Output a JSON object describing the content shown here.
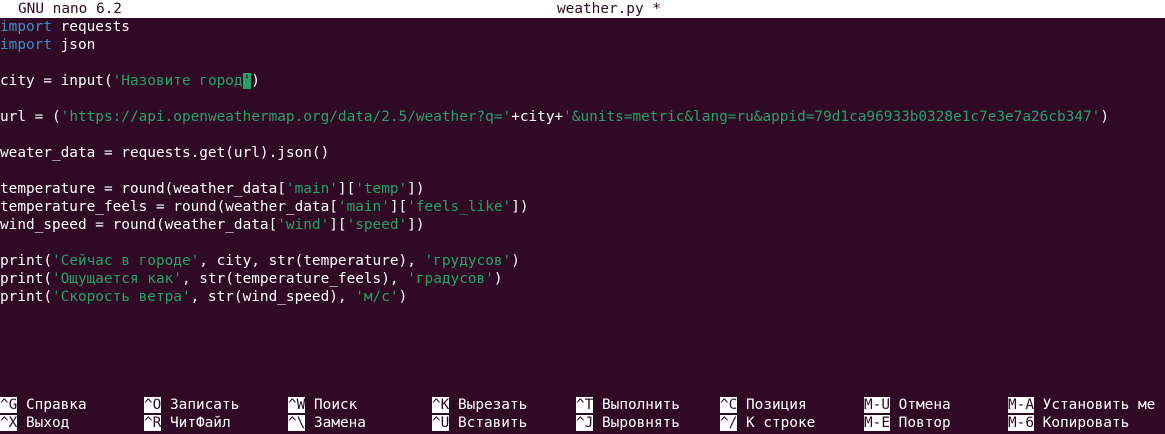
{
  "titlebar": {
    "app": "GNU nano 6.2",
    "file": "weather.py *"
  },
  "code": {
    "l1": {
      "kw": "import",
      "rest": " requests"
    },
    "l2": {
      "kw": "import",
      "rest": " json"
    },
    "l4": {
      "a": "city = input(",
      "s": "'Назовите город",
      "cur": "'",
      "b": ")"
    },
    "l6": {
      "a": "url = (",
      "s1": "'https://api.openweathermap.org/data/2.5/weather?q='",
      "b": "+city+",
      "s2": "'&units=metric&lang=ru&appid=79d1ca96933b0328e1c7e3e7a26cb347'",
      "c": ")"
    },
    "l8": {
      "a": "weater_data = requests.get(url).json()"
    },
    "l10": {
      "a": "temperature = round(weather_data[",
      "s1": "'main'",
      "b": "][",
      "s2": "'temp'",
      "c": "])"
    },
    "l11": {
      "a": "temperature_feels = round(weather_data[",
      "s1": "'main'",
      "b": "][",
      "s2": "'feels_like'",
      "c": "])"
    },
    "l12": {
      "a": "wind_speed = round(weather_data[",
      "s1": "'wind'",
      "b": "][",
      "s2": "'speed'",
      "c": "])"
    },
    "l14": {
      "a": "print(",
      "s1": "'Сейчас в городе'",
      "b": ", city, str(temperature), ",
      "s2": "'грудусов'",
      "c": ")"
    },
    "l15": {
      "a": "print(",
      "s1": "'Ощущается как'",
      "b": ", str(temperature_feels), ",
      "s2": "'градусов'",
      "c": ")"
    },
    "l16": {
      "a": "print(",
      "s1": "'Скорость ветра'",
      "b": ", str(wind_speed), ",
      "s2": "'м/с'",
      "c": ")"
    }
  },
  "shortcuts": {
    "row1": [
      {
        "key": "^G",
        "label": " Справка"
      },
      {
        "key": "^O",
        "label": " Записать"
      },
      {
        "key": "^W",
        "label": " Поиск"
      },
      {
        "key": "^K",
        "label": " Вырезать"
      },
      {
        "key": "^T",
        "label": " Выполнить"
      },
      {
        "key": "^C",
        "label": " Позиция"
      },
      {
        "key": "M-U",
        "label": " Отмена"
      },
      {
        "key": "M-A",
        "label": " Установить ме"
      }
    ],
    "row2": [
      {
        "key": "^X",
        "label": " Выход"
      },
      {
        "key": "^R",
        "label": " ЧитФайл"
      },
      {
        "key": "^\\",
        "label": " Замена"
      },
      {
        "key": "^U",
        "label": " Вставить"
      },
      {
        "key": "^J",
        "label": " Выровнять"
      },
      {
        "key": "^/",
        "label": " К строке"
      },
      {
        "key": "M-E",
        "label": " Повтор"
      },
      {
        "key": "M-6",
        "label": " Копировать"
      }
    ]
  }
}
